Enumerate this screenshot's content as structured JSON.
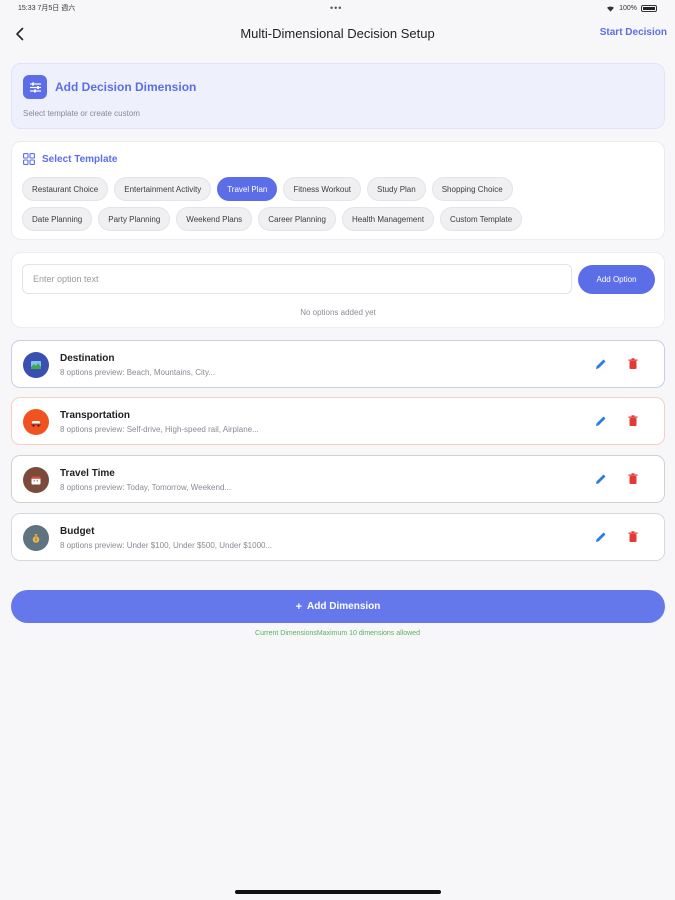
{
  "status_bar": {
    "time_date": "15:33  7月5日 週六",
    "dots": "•••",
    "battery": "100%"
  },
  "nav": {
    "title": "Multi-Dimensional Decision Setup",
    "action_label": "Start Decision"
  },
  "hero": {
    "title": "Add Decision Dimension",
    "subtitle": "Select template or create custom",
    "icon": "sliders-icon"
  },
  "templates": {
    "title": "Select Template",
    "icon": "grid-icon",
    "row1": [
      "Restaurant Choice",
      "Entertainment Activity",
      "Travel Plan",
      "Fitness Workout",
      "Study Plan",
      "Shopping Choice"
    ],
    "row2": [
      "Date Planning",
      "Party Planning",
      "Weekend Plans",
      "Career Planning",
      "Health Management",
      "Custom Template"
    ],
    "selected": "Travel Plan"
  },
  "option_entry": {
    "placeholder": "Enter option text",
    "value": "",
    "add_label": "Add Option",
    "empty_text": "No options added yet"
  },
  "dimensions": [
    {
      "title": "Destination",
      "preview": "8  options preview: Beach, Mountains, City...",
      "icon": "map-icon",
      "color": "#3a4fb0"
    },
    {
      "title": "Transportation",
      "preview": "8  options preview: Self-drive, High-speed rail, Airplane...",
      "icon": "car-icon",
      "color": "#f0531f"
    },
    {
      "title": "Travel Time",
      "preview": "8  options preview: Today, Tomorrow, Weekend...",
      "icon": "calendar-icon",
      "color": "#7a4a3a"
    },
    {
      "title": "Budget",
      "preview": "8  options preview: Under $100, Under $500, Under $1000...",
      "icon": "money-bag-icon",
      "color": "#5f7380"
    }
  ],
  "add_dimension": {
    "label": "Add Dimension",
    "hint": "Current DimensionsMaximum 10 dimensions allowed"
  },
  "colors": {
    "accent": "#5b6ee8",
    "edit": "#2a7be4",
    "delete": "#e53935",
    "hint": "#5fae5f"
  }
}
